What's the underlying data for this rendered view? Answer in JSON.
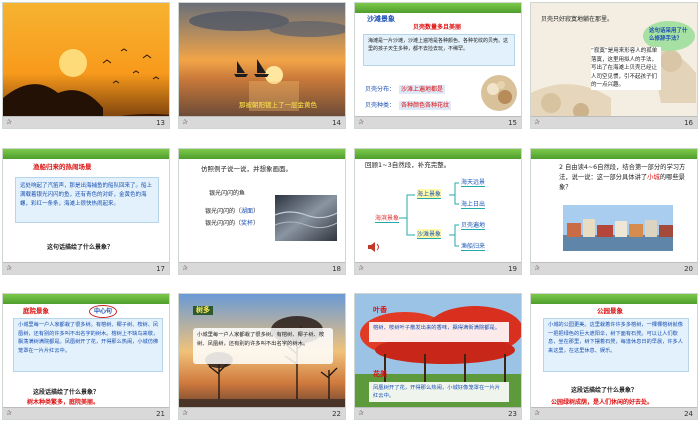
{
  "slides": [
    {
      "num": "13"
    },
    {
      "num": "14",
      "caption": "那被朝阳镀上了一层金黄色"
    },
    {
      "num": "15",
      "title": "沙滩景象",
      "subtitle": "贝壳数量多且美丽",
      "body": "海滩是一片沙滩，沙滩上遍地是各种颜色、各种花纹的贝壳。这里的孩子天生多种，都不去捡去玩，不稀罕。",
      "line1_label": "贝壳分布：",
      "line1_value": "沙滩上遍地都是",
      "line2_label": "贝壳种类：",
      "line2_value": "各种颜色各种花纹"
    },
    {
      "num": "16",
      "text1": "贝壳只好寂寞地躺在那里。",
      "bubble": "这句话采用了什么修辞手法？",
      "text2": "“寂寞”是用来形容人的孤单落寞，这里用拟人的手法，写出了在海滩上贝壳已经让人司空见惯，引不起孩子们的一点兴趣。"
    },
    {
      "num": "17",
      "title": "渔船归来的热闹场景",
      "body": "远处响起了汽笛声，那是出海捕鱼的船队回来了。船上满载着银光闪闪的鱼，还有青色的对虾，金黄色的海螺，彩红一条条，海滩上很快热闹起来。",
      "question": "这句话描绘了什么景象？"
    },
    {
      "num": "18",
      "prompt": "仿照例子说一说，并想象画面。",
      "line1": "银光闪闪的鱼",
      "line2a": "银光闪闪的（",
      "line2b": "湖面",
      "line2c": "）",
      "line3a": "银光闪闪的（",
      "line3b": "奖杯",
      "line3c": "）"
    },
    {
      "num": "19",
      "prompt": "回顾1~3自然段，补充完整。",
      "root": "海滨景象",
      "mid1": "海上景象",
      "mid2": "沙滩景象",
      "leaf1": "海天远景",
      "leaf2": "海上日出",
      "leaf3": "贝壳遍地",
      "leaf4": "渔船归来"
    },
    {
      "num": "20",
      "prompt": "2 自由读4~6自然段，结合第一部分的学习方法，说一说：这一部分具体讲了",
      "prompt_red": "小城",
      "prompt_end": "的哪些景象？"
    },
    {
      "num": "21",
      "title": "庭院景象",
      "tag": "中心句",
      "body": "小城里每一户人家都栽了很多树。有榕树、椰子树、桉树、凤凰树，还有别的许多叫不出名字的树木。榕树上不缺鸟来歇，飘荡满树满院都是。凤凰树开了花，开得那么热闹，小城仿佛笼罩在一片片红云中。",
      "question": "这段话描绘了什么景象？",
      "answer": "树木种类繁多，庭院美丽。"
    },
    {
      "num": "22",
      "title": "树多",
      "body": "小城里每一户人家都栽了很多树。有榕树、椰子树、桉树、凤凰树，还有别的许多叫不出名字的树木。"
    },
    {
      "num": "23",
      "label1": "叶香",
      "text1": "榕树、桉树叶子散发出来的香味，飘得满街满院都是。",
      "label2": "花美",
      "text2": "凤凰树开了花，开得那么热闹，小城好像笼罩在一片片红云中。"
    },
    {
      "num": "24",
      "title": "公园景象",
      "body": "小城的公园更美。这里栽着许许多多榕树，一棵棵榕树就像一把把绿色的巨大遮阳伞，树下面有石凳。可以让人们歇息，坐在那里，树下摆着石凳，每逢休息日的早晨，许多人来这里，在这里休息、娱乐。",
      "question": "这段话描绘了什么景象？",
      "answer": "公园绿树成荫，是人们休闲的好去处。"
    }
  ]
}
